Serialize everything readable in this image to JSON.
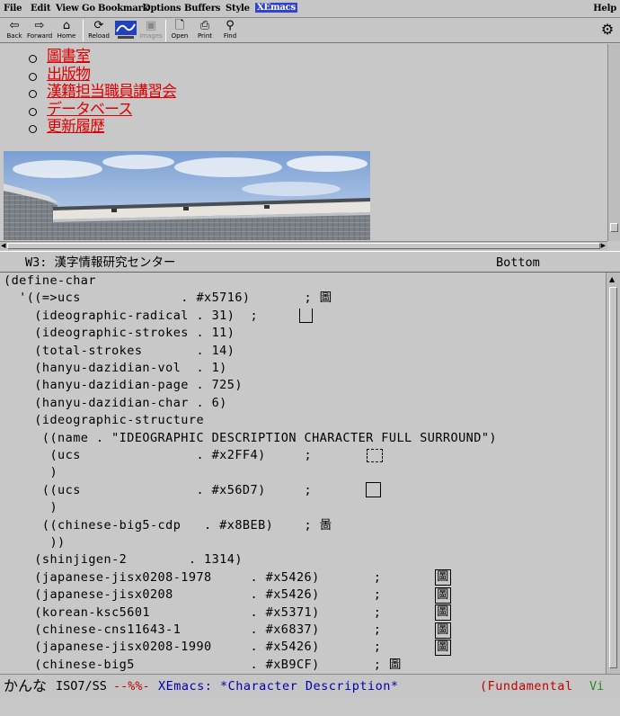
{
  "menubar": {
    "items": [
      "File",
      "Edit",
      "View",
      "Go",
      "Bookmark",
      "Options",
      "Buffers",
      "Style",
      "XEmacs"
    ],
    "help": "Help"
  },
  "toolbar": {
    "back": "Back",
    "forward": "Forward",
    "home": "Home",
    "reload": "Reload",
    "images": "Images",
    "open": "Open",
    "print": "Print",
    "find": "Find"
  },
  "page_links": [
    "圖書室",
    "出版物",
    "漢籍担当職員講習会",
    "データベース",
    "更新履歴"
  ],
  "upper_modeline": {
    "buffer": "W3: 漢字情報研究センター",
    "position": "Bottom"
  },
  "lower_lines": [
    "(define-char",
    "  '((=>ucs             . #x5716)       ; 圖",
    "    (ideographic-radical . 31)  ;",
    "    (ideographic-strokes . 11)",
    "    (total-strokes       . 14)",
    "    (hanyu-dazidian-vol  . 1)",
    "    (hanyu-dazidian-page . 725)",
    "    (hanyu-dazidian-char . 6)",
    "    (ideographic-structure",
    "     ((name . \"IDEOGRAPHIC DESCRIPTION CHARACTER FULL SURROUND\")",
    "      (ucs               . #x2FF4)     ;",
    "      )",
    "     ((ucs               . #x56D7)     ;",
    "      )",
    "     ((chinese-big5-cdp   . #x8BEB)    ; 啚",
    "      ))",
    "    (shinjigen-2        . 1314)",
    "    (japanese-jisx0208-1978     . #x5426)       ;",
    "    (japanese-jisx0208          . #x5426)       ;",
    "    (korean-ksc5601             . #x5371)       ;",
    "    (chinese-cns11643-1         . #x6837)       ;",
    "    (japanese-jisx0208-1990     . #x5426)       ;",
    "    (chinese-big5               . #xB9CF)       ; 圖"
  ],
  "boxed_glyphs": [
    "圖",
    "圖",
    "圖",
    "圖",
    "圖"
  ],
  "bottom_modeline": {
    "ime": "かんな",
    "coding": "ISO7/SS",
    "modified": "--%%-",
    "app": "XEmacs: *Character Description*",
    "mode": "(Fundamental",
    "minor": "Vi"
  }
}
